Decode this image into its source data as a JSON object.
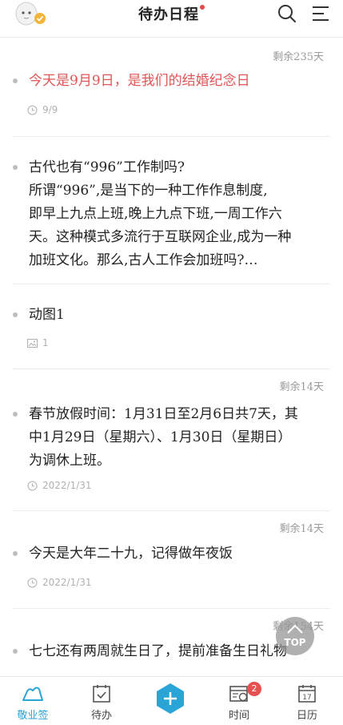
{
  "header": {
    "title": "待办日程"
  },
  "items": [
    {
      "remain": "剩余235天",
      "lines": [
        "今天是9月9日，是我们的结婚纪念日"
      ],
      "meta_type": "date",
      "meta": "9/9",
      "highlight": true
    },
    {
      "remain": "",
      "lines": [
        "古代也有“996”工作制吗?",
        "所谓“996”,是当下的一种工作作息制度,",
        "即早上九点上班,晚上九点下班,一周工作六",
        "天。这种模式多流行于互联网企业,成为一种",
        "加班文化。那么,古人工作会加班吗?…"
      ],
      "meta_type": "none",
      "meta": "",
      "highlight": false
    },
    {
      "remain": "",
      "lines": [
        "动图1"
      ],
      "meta_type": "image",
      "meta": "1",
      "highlight": false
    },
    {
      "remain": "剩余14天",
      "lines": [
        "春节放假时间：1月31日至2月6日共7天，其",
        "中1月29日（星期六）、1月30日（星期日）",
        "为调休上班。"
      ],
      "meta_type": "date",
      "meta": "2022/1/31",
      "highlight": false
    },
    {
      "remain": "剩余14天",
      "lines": [
        "今天是大年二十九，记得做年夜饭"
      ],
      "meta_type": "date",
      "meta": "2022/1/31",
      "highlight": false
    },
    {
      "remain": "剩余154天",
      "lines": [
        "七七还有两周就生日了，提前准备生日礼物"
      ],
      "meta_type": "none",
      "meta": "",
      "highlight": false
    }
  ],
  "top_button": {
    "label": "TOP"
  },
  "nav": {
    "items": [
      {
        "label": "敬业签",
        "icon": "cloud-note-icon",
        "active": true
      },
      {
        "label": "待办",
        "icon": "todo-icon",
        "active": false
      },
      {
        "label": "",
        "icon": "add-icon",
        "active": false
      },
      {
        "label": "时间",
        "icon": "time-icon",
        "active": false
      },
      {
        "label": "日历",
        "icon": "calendar-icon",
        "active": false
      }
    ],
    "time_badge": "2",
    "calendar_day": "17"
  },
  "colors": {
    "accent": "#2aa3d6",
    "highlight_text": "#e05555",
    "badge": "#e65050"
  }
}
